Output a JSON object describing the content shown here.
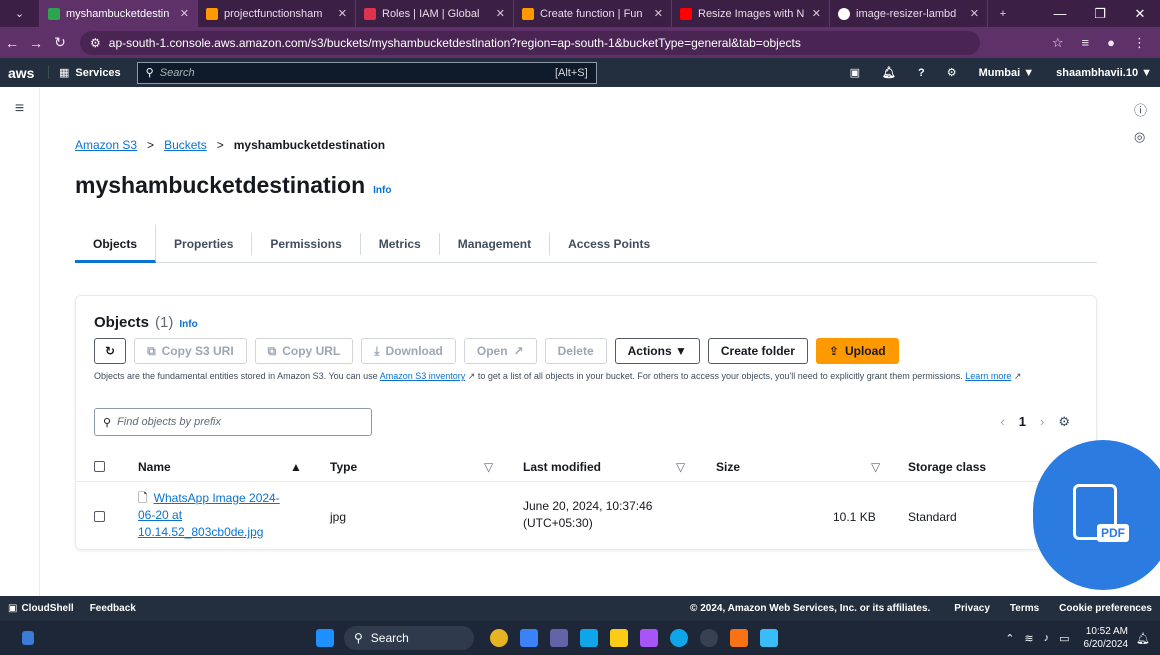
{
  "browser": {
    "tabs": [
      {
        "title": "myshambucketdestin",
        "color": "#2ea44f",
        "active": true
      },
      {
        "title": "projectfunctionsham",
        "color": "#ff9900",
        "active": false
      },
      {
        "title": "Roles | IAM | Global",
        "color": "#dd344c",
        "active": false
      },
      {
        "title": "Create function | Fun",
        "color": "#ff9900",
        "active": false
      },
      {
        "title": "Resize Images with N",
        "color": "#ff0000",
        "active": false
      },
      {
        "title": "image-resizer-lambd",
        "color": "#ffffff",
        "active": false
      }
    ],
    "new_tab": "+",
    "url": "ap-south-1.console.aws.amazon.com/s3/buckets/myshambucketdestination?region=ap-south-1&bucketType=general&tab=objects"
  },
  "aws_nav": {
    "logo": "aws",
    "services": "Services",
    "search_placeholder": "Search",
    "search_shortcut": "[Alt+S]",
    "region": "Mumbai ▼",
    "user": "shaambhavii.10 ▼"
  },
  "breadcrumb": {
    "items": [
      "Amazon S3",
      "Buckets",
      "myshambucketdestination"
    ],
    "sep": ">"
  },
  "page": {
    "title": "myshambucketdestination",
    "info": "Info"
  },
  "tabs": [
    "Objects",
    "Properties",
    "Permissions",
    "Metrics",
    "Management",
    "Access Points"
  ],
  "objects_panel": {
    "title": "Objects",
    "count": "(1)",
    "info": "Info",
    "buttons": {
      "copy_s3_uri": "Copy S3 URI",
      "copy_url": "Copy URL",
      "download": "Download",
      "open": "Open",
      "delete": "Delete",
      "actions": "Actions ▼",
      "create_folder": "Create folder",
      "upload": "Upload"
    },
    "desc_1": "Objects are the fundamental entities stored in Amazon S3. You can use",
    "desc_link": "Amazon S3 inventory",
    "desc_2": "to get a list of all objects in your bucket. For others to access your objects, you'll need to explicitly grant them permissions.",
    "learn_more": "Learn more",
    "find_placeholder": "Find objects by prefix",
    "page": "1",
    "columns": [
      "Name",
      "Type",
      "Last modified",
      "Size",
      "Storage class"
    ],
    "row": {
      "name_1": "WhatsApp Image 2024-",
      "name_2": "06-20 at",
      "name_3": "10.14.52_803cb0de.jpg",
      "type": "jpg",
      "modified_1": "June 20, 2024, 10:37:46",
      "modified_2": "(UTC+05:30)",
      "size": "10.1 KB",
      "storage": "Standard"
    }
  },
  "pdf_badge": "PDF",
  "footer": {
    "cloudshell": "CloudShell",
    "feedback": "Feedback",
    "copyright": "© 2024, Amazon Web Services, Inc. or its affiliates.",
    "privacy": "Privacy",
    "terms": "Terms",
    "cookies": "Cookie preferences"
  },
  "taskbar": {
    "search": "Search",
    "time": "10:52 AM",
    "date": "6/20/2024"
  }
}
